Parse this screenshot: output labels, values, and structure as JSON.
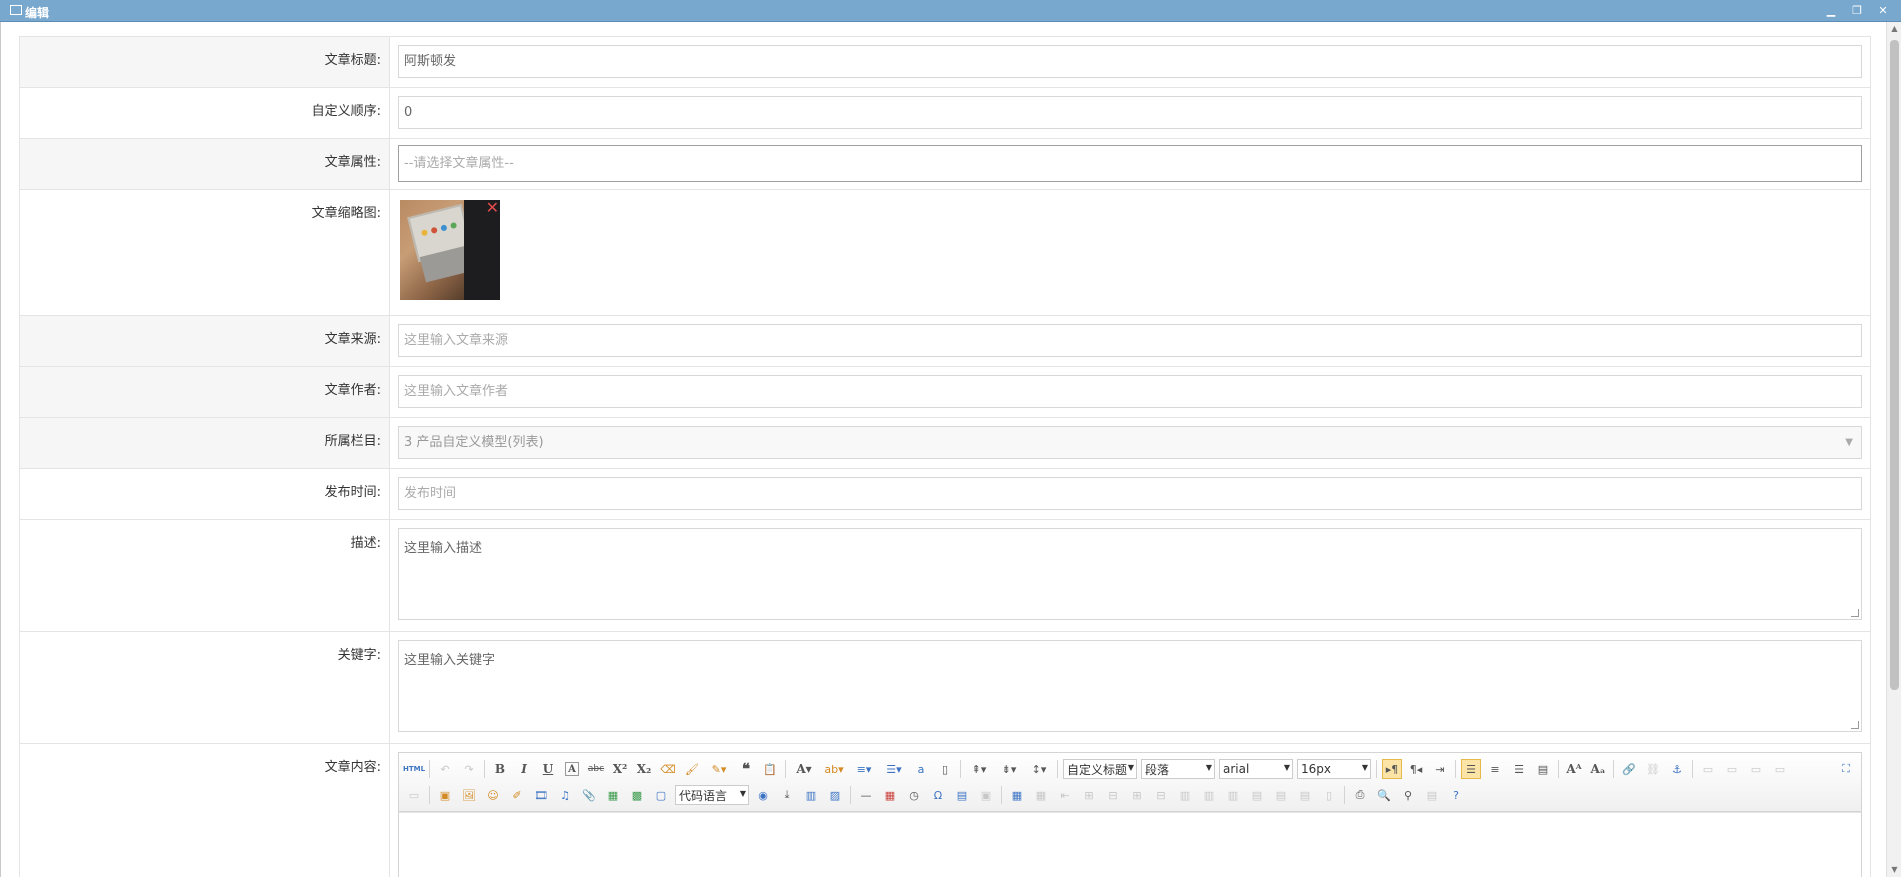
{
  "window": {
    "title": "编辑",
    "controls": [
      "minimize",
      "restore",
      "close"
    ]
  },
  "form": {
    "title": {
      "label": "文章标题:",
      "value": "阿斯顿发"
    },
    "order": {
      "label": "自定义顺序:",
      "value": "0"
    },
    "attribute": {
      "label": "文章属性:",
      "placeholder": "--请选择文章属性--"
    },
    "thumbnail": {
      "label": "文章缩略图:"
    },
    "source": {
      "label": "文章来源:",
      "placeholder": "这里输入文章来源"
    },
    "author": {
      "label": "文章作者:",
      "placeholder": "这里输入文章作者"
    },
    "category": {
      "label": "所属栏目:",
      "value": "3 产品自定义模型(列表)"
    },
    "publish_time": {
      "label": "发布时间:",
      "placeholder": "发布时间"
    },
    "description": {
      "label": "描述:",
      "placeholder": "这里输入描述"
    },
    "keywords": {
      "label": "关键字:",
      "placeholder": "这里输入关键字"
    },
    "content": {
      "label": "文章内容:"
    }
  },
  "editor": {
    "html_label": "HTML",
    "custom_heading": "自定义标题",
    "paragraph": "段落",
    "font_family": "arial",
    "font_size": "16px",
    "code_language": "代码语言"
  },
  "colors": {
    "titlebar": "#79a8ce",
    "active_button": "#fbe4a6",
    "border": "#e4e4e4"
  }
}
